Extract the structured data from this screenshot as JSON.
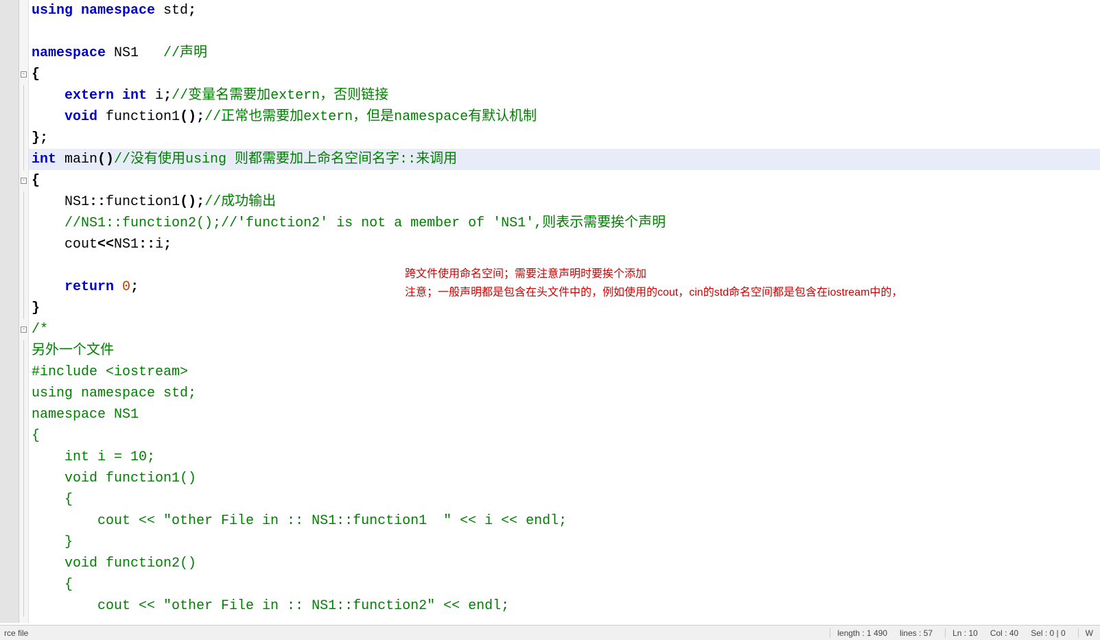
{
  "lines": [
    {
      "t": [
        {
          "c": "kw",
          "s": "using namespace"
        },
        {
          "c": "",
          "s": " std"
        },
        {
          "c": "punct",
          "s": ";"
        }
      ]
    },
    {
      "t": []
    },
    {
      "t": [
        {
          "c": "kw",
          "s": "namespace"
        },
        {
          "c": "",
          "s": " NS1   "
        },
        {
          "c": "cmt",
          "s": "//声明"
        }
      ]
    },
    {
      "fold": "open",
      "t": [
        {
          "c": "punct",
          "s": "{"
        }
      ]
    },
    {
      "indent": 1,
      "t": [
        {
          "c": "kw",
          "s": "extern int"
        },
        {
          "c": "",
          "s": " i"
        },
        {
          "c": "punct",
          "s": ";"
        },
        {
          "c": "cmt",
          "s": "//变量名需要加extern，否则链接"
        }
      ]
    },
    {
      "indent": 1,
      "t": [
        {
          "c": "kw",
          "s": "void"
        },
        {
          "c": "",
          "s": " function1"
        },
        {
          "c": "punct",
          "s": "();"
        },
        {
          "c": "cmt",
          "s": "//正常也需要加extern，但是namespace有默认机制"
        }
      ]
    },
    {
      "t": [
        {
          "c": "punct",
          "s": "};"
        }
      ]
    },
    {
      "hl": true,
      "t": [
        {
          "c": "kw",
          "s": "int"
        },
        {
          "c": "",
          "s": " main"
        },
        {
          "c": "punct",
          "s": "()"
        },
        {
          "c": "cmt",
          "s": "//没有使用using 则都需要加上命名空间名字::来调用"
        }
      ]
    },
    {
      "fold": "open",
      "t": [
        {
          "c": "punct",
          "s": "{"
        }
      ]
    },
    {
      "indent": 1,
      "t": [
        {
          "c": "",
          "s": "NS1"
        },
        {
          "c": "punct",
          "s": "::"
        },
        {
          "c": "",
          "s": "function1"
        },
        {
          "c": "punct",
          "s": "();"
        },
        {
          "c": "cmt",
          "s": "//成功输出"
        }
      ]
    },
    {
      "indent": 1,
      "t": [
        {
          "c": "cmt",
          "s": "//NS1::function2();//'function2' is not a member of 'NS1',则表示需要挨个声明"
        }
      ]
    },
    {
      "indent": 1,
      "t": [
        {
          "c": "",
          "s": "cout"
        },
        {
          "c": "punct",
          "s": "<<"
        },
        {
          "c": "",
          "s": "NS1"
        },
        {
          "c": "punct",
          "s": "::"
        },
        {
          "c": "",
          "s": "i"
        },
        {
          "c": "punct",
          "s": ";"
        }
      ]
    },
    {
      "t": []
    },
    {
      "indent": 1,
      "t": [
        {
          "c": "kw",
          "s": "return"
        },
        {
          "c": "",
          "s": " "
        },
        {
          "c": "num",
          "s": "0"
        },
        {
          "c": "punct",
          "s": ";"
        }
      ]
    },
    {
      "t": [
        {
          "c": "punct",
          "s": "}"
        }
      ]
    },
    {
      "fold": "open",
      "t": [
        {
          "c": "cmt",
          "s": "/*"
        }
      ]
    },
    {
      "t": [
        {
          "c": "cmt",
          "s": "另外一个文件"
        }
      ]
    },
    {
      "t": [
        {
          "c": "cmt",
          "s": "#include <iostream>"
        }
      ]
    },
    {
      "t": [
        {
          "c": "cmt",
          "s": "using namespace std;"
        }
      ]
    },
    {
      "t": [
        {
          "c": "cmt",
          "s": "namespace NS1"
        }
      ]
    },
    {
      "t": [
        {
          "c": "cmt",
          "s": "{"
        }
      ]
    },
    {
      "indent": 1,
      "t": [
        {
          "c": "cmt",
          "s": "int i = 10;"
        }
      ]
    },
    {
      "indent": 1,
      "t": [
        {
          "c": "cmt",
          "s": "void function1()"
        }
      ]
    },
    {
      "indent": 1,
      "t": [
        {
          "c": "cmt",
          "s": "{"
        }
      ]
    },
    {
      "indent": 2,
      "t": [
        {
          "c": "cmt",
          "s": "cout << \"other File in :: NS1::function1  \" << i << endl;"
        }
      ]
    },
    {
      "indent": 1,
      "t": [
        {
          "c": "cmt",
          "s": "}"
        }
      ]
    },
    {
      "indent": 1,
      "t": [
        {
          "c": "cmt",
          "s": "void function2()"
        }
      ]
    },
    {
      "indent": 1,
      "t": [
        {
          "c": "cmt",
          "s": "{"
        }
      ]
    },
    {
      "indent": 2,
      "t": [
        {
          "c": "cmt",
          "s": "cout << \"other File in :: NS1::function2\" << endl;"
        }
      ]
    }
  ],
  "annotation": {
    "line1": "跨文件使用命名空间；需要注意声明时要挨个添加",
    "line2": "注意；一般声明都是包含在头文件中的，例如使用的cout，cin的std命名空间都是包含在iostream中的，"
  },
  "statusbar": {
    "left": "rce file",
    "length": "length : 1 490",
    "lines": "lines : 57",
    "ln": "Ln : 10",
    "col": "Col : 40",
    "sel": "Sel : 0 | 0",
    "right_end": "W"
  }
}
